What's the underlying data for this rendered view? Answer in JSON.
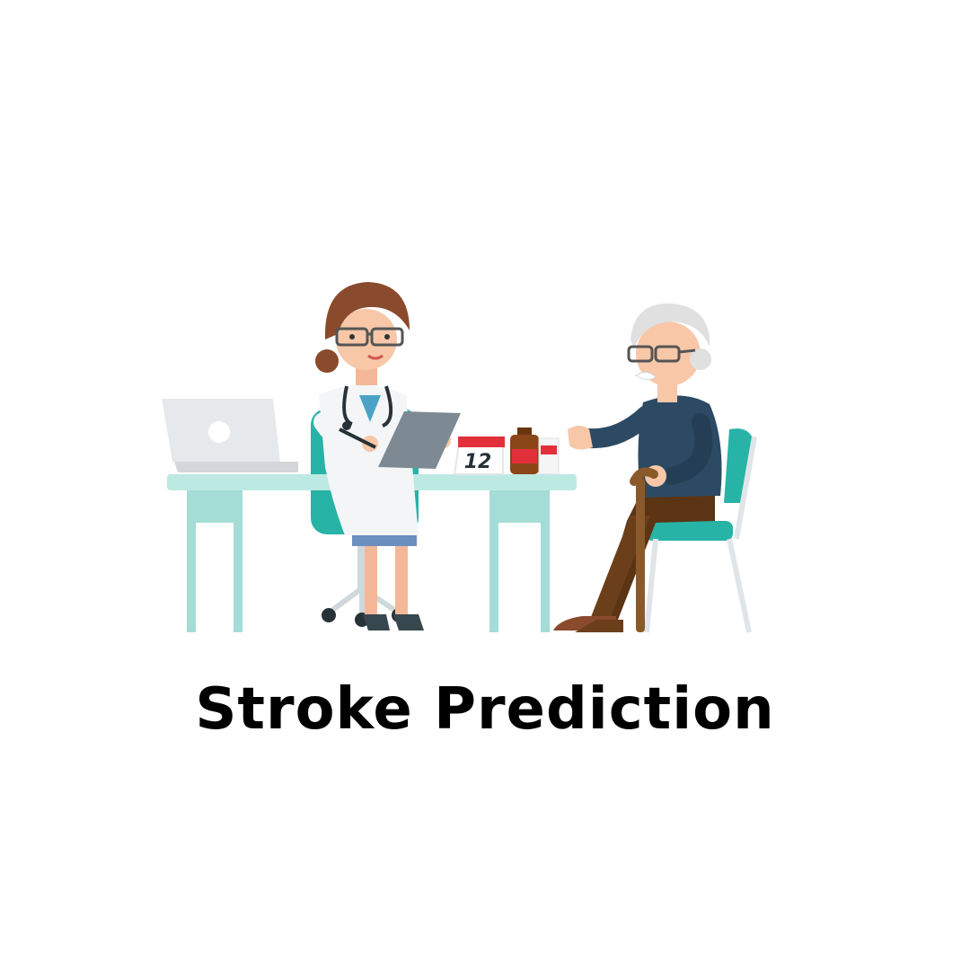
{
  "title": "Stroke Prediction",
  "illustration": {
    "calendar_day": "12"
  },
  "colors": {
    "desk": "#bde9e3",
    "chair_teal": "#27b3a6",
    "doctor_hair": "#8a4a2c",
    "patient_sweater": "#2c4a63",
    "patient_trousers": "#5b3414",
    "calendar_red": "#e2303a",
    "medicine_brown": "#8a4616"
  },
  "icons": [
    "laptop-icon",
    "stethoscope-icon",
    "tablet-icon",
    "calendar-icon",
    "medicine-bottle-icon",
    "walking-cane-icon"
  ]
}
